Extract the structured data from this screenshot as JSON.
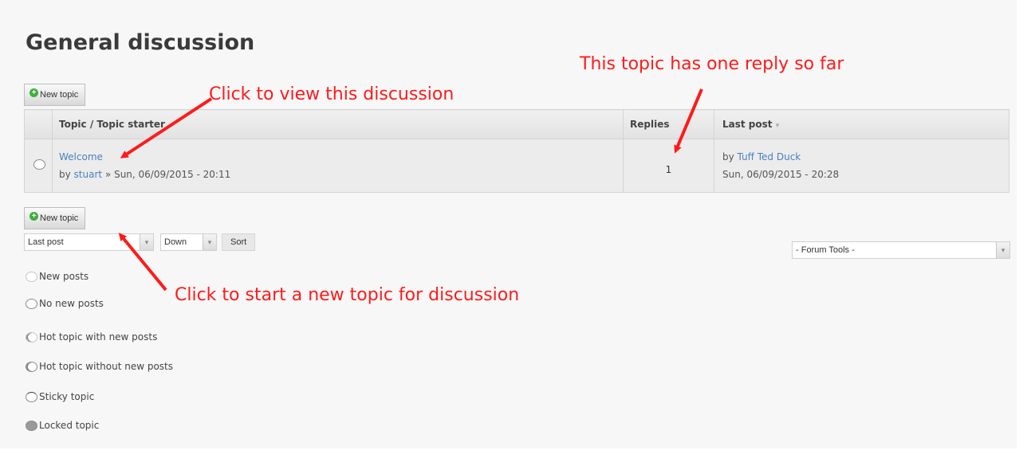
{
  "forum": {
    "title": "General discussion",
    "new_topic_label": "New topic",
    "table": {
      "headers": [
        "Topic / Topic starter",
        "Replies",
        "Last post"
      ],
      "rows": [
        {
          "topic": "Welcome",
          "by_prefix": "by",
          "starter": "stuart",
          "started": " » Sun, 06/09/2015 - 20:11",
          "replies": "1",
          "last_by_prefix": "by",
          "last_user": "Tuff Ted Duck",
          "last_time": "Sun, 06/09/2015 - 20:28"
        }
      ]
    },
    "sort": {
      "field": "Last post",
      "order": "Down",
      "button": "Sort"
    },
    "tools_select": "- Forum Tools -",
    "legend": [
      {
        "label": "New posts",
        "icon": "new-posts-icon"
      },
      {
        "label": "No new posts",
        "icon": "no-new-posts-icon"
      },
      {
        "label": "Hot topic with new posts",
        "icon": "hot-new-icon"
      },
      {
        "label": "Hot topic without new posts",
        "icon": "hot-icon"
      },
      {
        "label": "Sticky topic",
        "icon": "sticky-icon"
      },
      {
        "label": "Locked topic",
        "icon": "locked-icon"
      }
    ]
  },
  "annotations": {
    "view_discussion": "Click to view this discussion",
    "one_reply": "This topic has one reply so far",
    "start_topic": "Click to start a new topic for discussion",
    "color": "#ff1a1a"
  }
}
